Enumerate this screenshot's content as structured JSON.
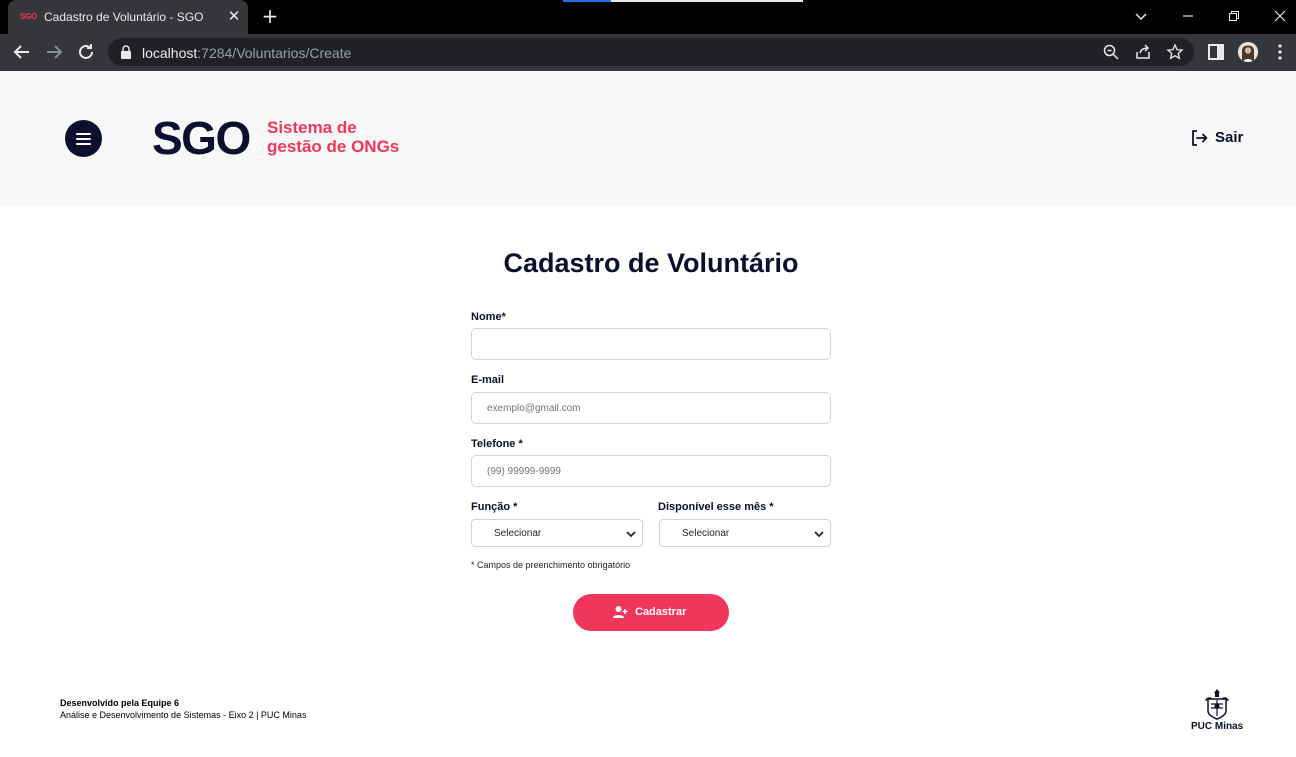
{
  "browser": {
    "tab_title": "Cadastro de Voluntário - SGO",
    "tab_favicon_text": "SGO",
    "url_host": "localhost",
    "url_path": ":7284/Voluntarios/Create"
  },
  "header": {
    "logo_text": "SGO",
    "logo_subtitle_line1": "Sistema de",
    "logo_subtitle_line2": "gestão de ONGs",
    "logout_label": "Sair"
  },
  "form": {
    "title": "Cadastro de Voluntário",
    "nome_label": "Nome*",
    "nome_value": "",
    "email_label": "E-mail",
    "email_placeholder": "exemplo@gmail.com",
    "telefone_label": "Telefone *",
    "telefone_placeholder": "(99) 99999-9999",
    "funcao_label": "Função *",
    "funcao_value": "Selecionar",
    "disponivel_label": "Disponível esse mês *",
    "disponivel_value": "Selecionar",
    "required_note": "* Campos de preenchimento obrigatório",
    "submit_label": "Cadastrar"
  },
  "footer": {
    "line1": "Desenvolvido pela Equipe 6",
    "line2": "Análise e Desenvolvimento de Sistemas - Eixo 2 | PUC Minas",
    "puc_label": "PUC Minas"
  },
  "colors": {
    "brand_dark": "#0c0f2e",
    "brand_accent": "#f0365a",
    "header_bg": "#f8f8f8"
  }
}
